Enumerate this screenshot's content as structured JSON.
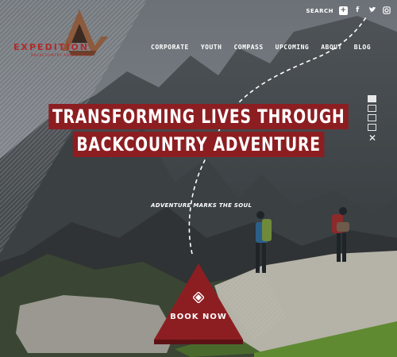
{
  "brand": {
    "name": "EXPEDITION",
    "tagline": "BACKCOUNTRY ADVENTURES"
  },
  "topbar": {
    "search_label": "SEARCH"
  },
  "nav": {
    "items": [
      "CORPORATE",
      "YOUTH",
      "COMPASS",
      "UPCOMING",
      "ABOUT",
      "BLOG"
    ]
  },
  "hero": {
    "headline_line1": "TRANSFORMING LIVES THROUGH",
    "headline_line2": "BACKCOUNTRY ADVENTURE",
    "tagline": "ADVENTURE MARKS THE SOUL"
  },
  "cta": {
    "label": "BOOK NOW"
  },
  "colors": {
    "brand_red": "#8c1e22",
    "logo_red": "#b12a2a"
  },
  "icons": [
    "plus-icon",
    "facebook-icon",
    "twitter-icon",
    "instagram-icon",
    "close-icon",
    "compass-icon"
  ]
}
